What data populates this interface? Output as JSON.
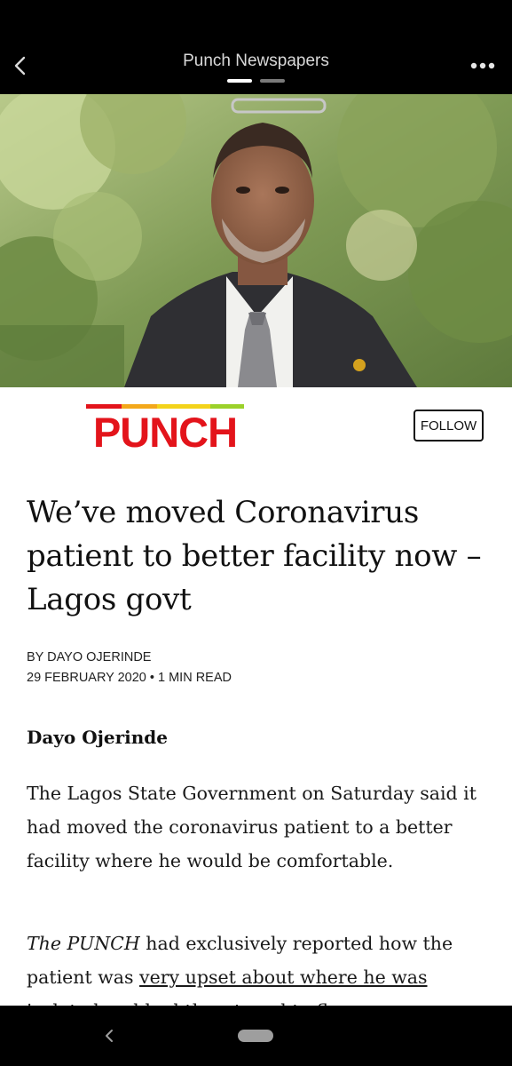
{
  "app_bar": {
    "title": "Punch Newspapers",
    "back_icon": "chevron-left-icon",
    "more_icon": "more-horizontal-icon",
    "page_indicator": {
      "count": 2,
      "active_index": 0
    }
  },
  "hero": {
    "alt_icon": "portrait-photo"
  },
  "publisher": {
    "logo_text": "PUNCH",
    "follow_label": "FOLLOW",
    "colors": {
      "logo_red": "#e3141b",
      "logo_stripe_green": "#9bd12a",
      "logo_stripe_yellow": "#f3d31a"
    }
  },
  "article": {
    "title": "We’ve moved Coronavirus patient to better facility now – Lagos govt",
    "byline": "BY DAYO OJERINDE",
    "meta": "29 FEBRUARY 2020 • 1 MIN READ",
    "author_heading": "Dayo Ojerinde",
    "paragraph1": "The Lagos State Government on Saturday said it had moved the coronavirus patient to a better facility where he would be comfortable.",
    "paragraph2_em": "The PUNCH",
    "paragraph2_text": " had exclusively reported how the patient was ",
    "paragraph2_link": "very upset about where he was",
    "paragraph2_tail": " isolated and had threatened to flee"
  },
  "nav_bar": {
    "back_icon": "nav-back-icon",
    "home_icon": "nav-home-pill-icon"
  }
}
